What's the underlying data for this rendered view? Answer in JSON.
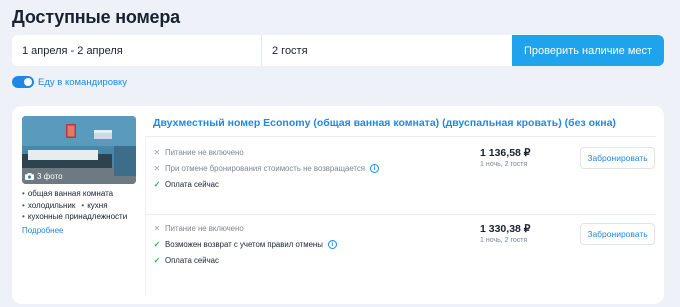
{
  "page": {
    "title": "Доступные номера"
  },
  "search": {
    "dates": "1 апреля - 2 апреля",
    "guests": "2 гостя",
    "check_label": "Проверить наличие мест"
  },
  "business_trip": {
    "label": "Еду в командировку",
    "enabled": true
  },
  "room": {
    "title": "Двухместный номер Economy (общая ванная комната) (двуспальная кровать) (без окна)",
    "photo_count": "3 фото",
    "amenities": [
      "общая ванная комната",
      "холодильник",
      "кухня",
      "кухонные принадлежности"
    ],
    "more_link": "Подробнее",
    "options": [
      {
        "conditions": [
          {
            "type": "negative",
            "text": "Питание не включено",
            "info": false
          },
          {
            "type": "negative",
            "text": "При отмене бронирования стоимость не возвращается",
            "info": true
          },
          {
            "type": "positive",
            "text": "Оплата сейчас",
            "info": false
          }
        ],
        "price": "1 136,58 ₽",
        "price_note": "1 ночь, 2 гостя",
        "book_label": "Забронировать"
      },
      {
        "conditions": [
          {
            "type": "negative",
            "text": "Питание не включено",
            "info": false
          },
          {
            "type": "positive",
            "text": "Возможен возврат с учетом правил отмены",
            "info": true
          },
          {
            "type": "positive",
            "text": "Оплата сейчас",
            "info": false
          }
        ],
        "price": "1 330,38 ₽",
        "price_note": "1 ночь, 2 гостя",
        "book_label": "Забронировать"
      }
    ]
  },
  "colors": {
    "accent": "#1e88e5",
    "button": "#1fa3ec",
    "positive": "#2eb34a"
  },
  "icons": {
    "photo": "camera-icon",
    "negative": "cross-icon",
    "positive": "check-icon",
    "info": "info-icon"
  }
}
